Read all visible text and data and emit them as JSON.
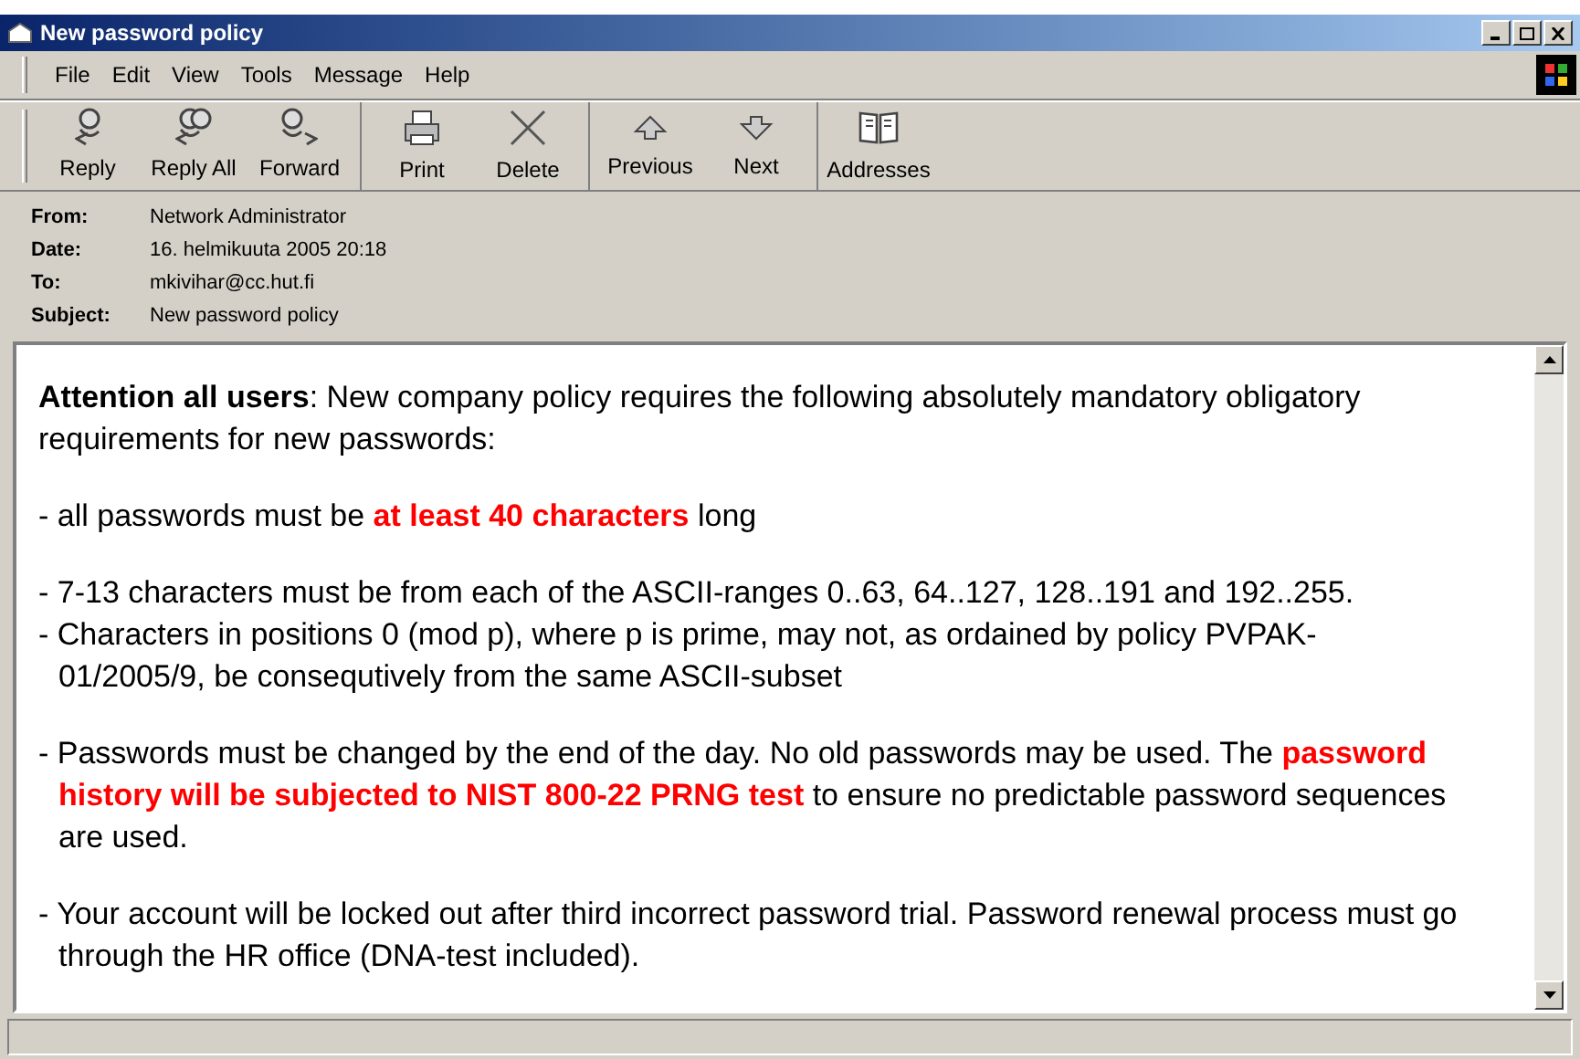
{
  "window": {
    "title": "New password policy"
  },
  "menu": [
    "File",
    "Edit",
    "View",
    "Tools",
    "Message",
    "Help"
  ],
  "toolbar": [
    [
      {
        "label": "Reply",
        "kind": "reply"
      },
      {
        "label": "Reply All",
        "kind": "replyall"
      },
      {
        "label": "Forward",
        "kind": "forward"
      }
    ],
    [
      {
        "label": "Print",
        "kind": "print"
      },
      {
        "label": "Delete",
        "kind": "delete"
      }
    ],
    [
      {
        "label": "Previous",
        "kind": "up"
      },
      {
        "label": "Next",
        "kind": "down"
      }
    ],
    [
      {
        "label": "Addresses",
        "kind": "book"
      }
    ]
  ],
  "headers": [
    {
      "label": "From:",
      "value": "Network Administrator"
    },
    {
      "label": "Date:",
      "value": "16. helmikuuta 2005 20:18"
    },
    {
      "label": "To:",
      "value": "mkivihar@cc.hut.fi"
    },
    {
      "label": "Subject:",
      "value": "New password policy"
    }
  ],
  "body": [
    [
      [
        {
          "text": "Attention all users",
          "kind": "bold"
        },
        {
          "text": ": New company policy requires the following absolutely mandatory obligatory requirements for new passwords:",
          "kind": "plain"
        }
      ]
    ],
    [
      [
        {
          "text": "- all passwords must be ",
          "kind": "plain"
        },
        {
          "text": "at least 40 characters",
          "kind": "alert"
        },
        {
          "text": " long",
          "kind": "plain"
        }
      ]
    ],
    [
      [
        {
          "text": "- 7-13 characters must be from each of the ASCII-ranges 0..63, 64..127, 128..191 and 192..255.",
          "kind": "plain"
        }
      ],
      [
        {
          "text": "- Characters in positions 0 (mod p), where p is prime, may not, as ordained by policy PVPAK-01/2005/9, be consequtively from the same ASCII-subset",
          "kind": "plain"
        }
      ]
    ],
    [
      [
        {
          "text": "- Passwords must be changed by the end of the day. No old passwords may be used. The ",
          "kind": "plain"
        },
        {
          "text": "password history will be subjected to NIST 800-22 PRNG test",
          "kind": "alert"
        },
        {
          "text": " to ensure no predictable password sequences are used.",
          "kind": "plain"
        }
      ]
    ],
    [
      [
        {
          "text": "- Your account will be locked out after third incorrect password trial. Password renewal process must go through the HR office (DNA-test included).",
          "kind": "plain"
        }
      ]
    ]
  ]
}
